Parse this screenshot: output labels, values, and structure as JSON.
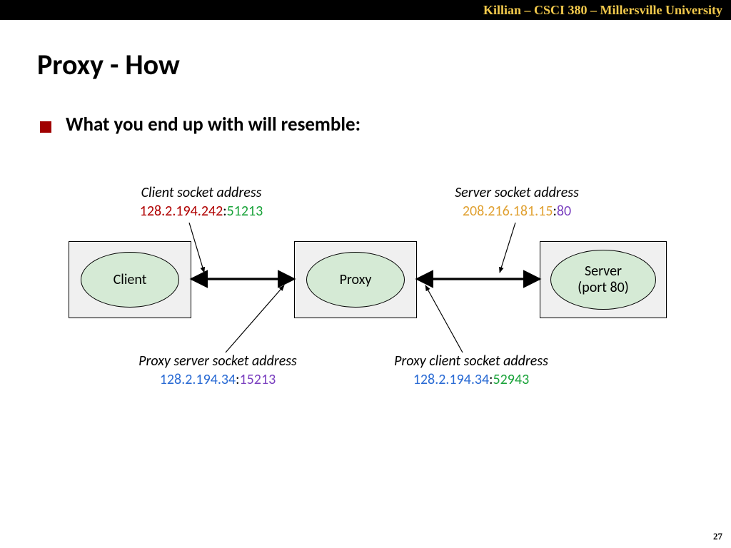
{
  "header": "Killian – CSCI 380 – Millersville University",
  "title": "Proxy - How",
  "bullet": "What you end up with will resemble:",
  "slide_number": "27",
  "nodes": {
    "client": "Client",
    "proxy": "Proxy",
    "server_line1": "Server",
    "server_line2": "(port 80)"
  },
  "labels": {
    "client": {
      "caption": "Client socket address",
      "ip": "128.2.194.242",
      "port": "51213"
    },
    "server": {
      "caption": "Server socket address",
      "ip": "208.216.181.15",
      "port": "80"
    },
    "proxysrv": {
      "caption": "Proxy server socket address",
      "ip": "128.2.194.34",
      "port": "15213"
    },
    "proxycli": {
      "caption": "Proxy client socket address",
      "ip": "128.2.194.34",
      "port": "52943"
    }
  }
}
